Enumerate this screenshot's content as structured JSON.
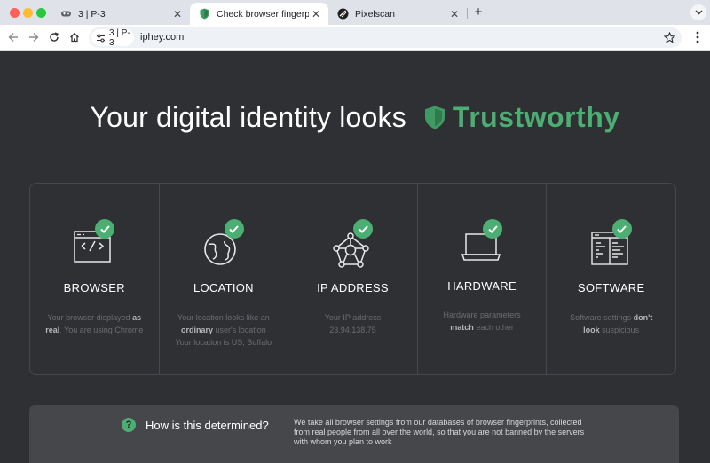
{
  "browser": {
    "tabs": [
      {
        "title": "3 | P-3",
        "favicon": "gamepad-icon",
        "active": false
      },
      {
        "title": "Check browser fingerprints",
        "favicon": "shield-icon",
        "active": true
      },
      {
        "title": "Pixelscan",
        "favicon": "pixelscan-icon",
        "active": false
      }
    ],
    "site_chip": "3 | P-3",
    "url": "iphey.com"
  },
  "page": {
    "headline": "Your digital identity looks",
    "verdict": "Trustworthy",
    "colors": {
      "accent": "#4cae72",
      "background": "#2f3033",
      "muted": "#6b6d72"
    },
    "cards": [
      {
        "name": "BROWSER",
        "icon": "browser-code-icon",
        "desc": [
          [
            "Your browser displayed ",
            false
          ],
          [
            "as",
            true
          ],
          [
            "\n",
            false
          ],
          [
            "real",
            true
          ],
          [
            ". You are using Chrome",
            false
          ]
        ]
      },
      {
        "name": "LOCATION",
        "icon": "globe-icon",
        "desc": [
          [
            "Your location looks like an",
            false
          ],
          [
            "\n",
            false
          ],
          [
            "ordinary",
            true
          ],
          [
            " user's location",
            false
          ],
          [
            "\n",
            false
          ],
          [
            "Your location is US, Buffalo",
            false
          ]
        ]
      },
      {
        "name": "IP ADDRESS",
        "icon": "network-icon",
        "desc": [
          [
            "Your IP address 23.94.138.75",
            false
          ]
        ]
      },
      {
        "name": "HARDWARE",
        "icon": "laptop-icon",
        "desc": [
          [
            "Hardware parameters",
            false
          ],
          [
            "\n",
            false
          ],
          [
            "match",
            true
          ],
          [
            " each other",
            false
          ]
        ]
      },
      {
        "name": "SOFTWARE",
        "icon": "software-window-icon",
        "desc": [
          [
            "Software settings ",
            false
          ],
          [
            "don't",
            true
          ],
          [
            "\n",
            false
          ],
          [
            "look",
            true
          ],
          [
            " suspicious",
            false
          ]
        ]
      }
    ],
    "how": {
      "question": "How is this determined?",
      "answer": "We take all browser settings from our databases of browser fingerprints, collected from real people from all over the world, so that you are not banned by the servers with whom you plan to work"
    }
  }
}
